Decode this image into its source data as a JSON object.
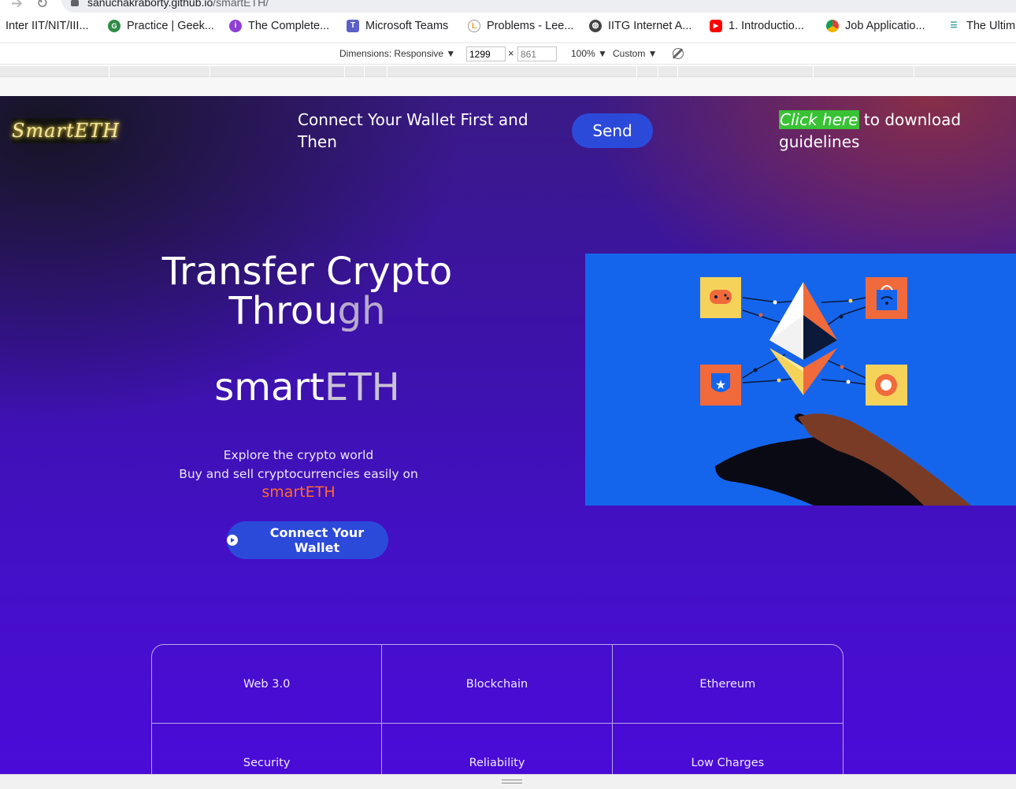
{
  "browser": {
    "url_host": "sanuchakraborty.github.io",
    "url_path": "/smartETH/",
    "bookmarks": [
      {
        "label": "Inter IIT/NIT/III...",
        "icon": "folder-icon"
      },
      {
        "label": "Practice | Geek...",
        "icon": "geeksforgeeks-icon"
      },
      {
        "label": "The Complete...",
        "icon": "course-icon"
      },
      {
        "label": "Microsoft Teams",
        "icon": "teams-icon"
      },
      {
        "label": "Problems - Lee...",
        "icon": "leetcode-icon"
      },
      {
        "label": "IITG Internet A...",
        "icon": "globe-icon"
      },
      {
        "label": "1. Introductio...",
        "icon": "youtube-icon"
      },
      {
        "label": "Job Applicatio...",
        "icon": "chrome-icon"
      },
      {
        "label": "The Ultim",
        "icon": "ultimate-icon"
      }
    ]
  },
  "devtools": {
    "dimensions_label": "Dimensions: Responsive ▼",
    "width_value": "1299",
    "times": "×",
    "height_placeholder": "861",
    "zoom": "100% ▼",
    "throttle": "Custom ▼"
  },
  "header": {
    "logo_text": "SmartETH",
    "message": "Connect Your Wallet First and Then",
    "send_label": "Send",
    "guide_link": "Click here",
    "guide_text": " to download guidelines"
  },
  "hero": {
    "title_line1": "Transfer Crypto",
    "title_line2a": "Throu",
    "title_line2b": "gh",
    "brand_a": "smart",
    "brand_b": "ETH",
    "explore_line1": "Explore the crypto world",
    "explore_line2": "Buy and sell cryptocurrencies easily on",
    "brand_small": "smartETH",
    "connect_label": "Connect Your Wallet"
  },
  "features": [
    "Web 3.0",
    "Blockchain",
    "Ethereum",
    "Security",
    "Reliability",
    "Low Charges"
  ],
  "colors": {
    "accent_button": "#2c4ad9",
    "link_highlight": "#38c234",
    "brand_orange": "#ff6a2d",
    "illustration_bg": "#1565ec"
  }
}
